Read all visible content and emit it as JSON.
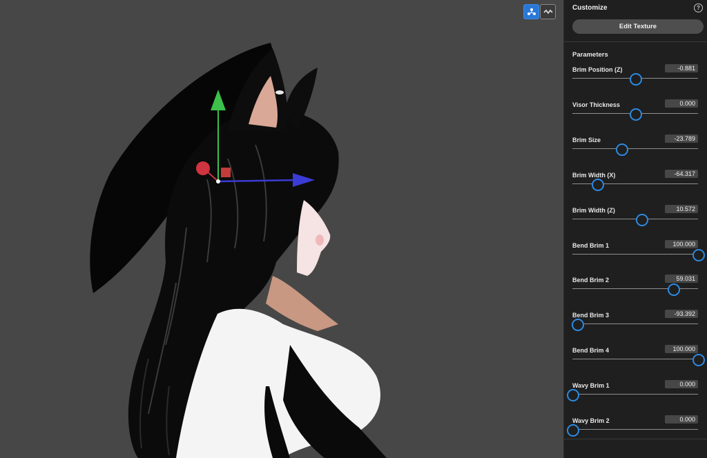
{
  "panel": {
    "title": "Customize",
    "edit_texture_label": "Edit Texture",
    "section_title": "Parameters",
    "params": [
      {
        "label": "Brim Position (Z)",
        "value": "-0.881",
        "fraction": 0.5
      },
      {
        "label": "Visor Thickness",
        "value": "0.000",
        "fraction": 0.5
      },
      {
        "label": "Brim Size",
        "value": "-23.789",
        "fraction": 0.39
      },
      {
        "label": "Brim Width (X)",
        "value": "-64.317",
        "fraction": 0.2
      },
      {
        "label": "Brim Width (Z)",
        "value": "10.572",
        "fraction": 0.55
      },
      {
        "label": "Bend Brim 1",
        "value": "100.000",
        "fraction": 1.0
      },
      {
        "label": "Bend Brim 2",
        "value": "59.031",
        "fraction": 0.8
      },
      {
        "label": "Bend Brim 3",
        "value": "-93.392",
        "fraction": 0.04
      },
      {
        "label": "Bend Brim 4",
        "value": "100.000",
        "fraction": 1.0
      },
      {
        "label": "Wavy Brim 1",
        "value": "0.000",
        "fraction": 0.0
      },
      {
        "label": "Wavy Brim 2",
        "value": "0.000",
        "fraction": 0.0
      }
    ]
  },
  "viewport": {
    "toggles": [
      {
        "icon": "transform-gizmo-icon",
        "active": true
      },
      {
        "icon": "wave-mode-icon",
        "active": false
      }
    ]
  },
  "colors": {
    "accent": "#2b8be3",
    "viewport_bg": "#474747",
    "panel_bg": "#1f1f1f"
  }
}
